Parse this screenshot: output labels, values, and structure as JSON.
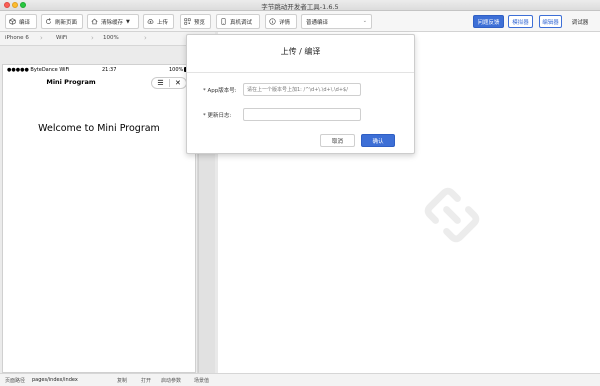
{
  "window": {
    "title": "字节跳动开发者工具-1.6.5"
  },
  "toolbar": {
    "compile": "编译",
    "refresh": "刷新页面",
    "clear_cache": "清除缓存",
    "upload": "上传",
    "preview": "预览",
    "device_debug": "真机调试",
    "details": "详情",
    "compile_mode": "普通编译",
    "feedback": "问题反馈",
    "simulator": "模拟器",
    "editor": "编辑器",
    "debugger": "调试器"
  },
  "devbar": {
    "device": "iPhone 6",
    "network": "WiFi",
    "zoom": "100%"
  },
  "phone": {
    "carrier": "●●●●● ByteDance WiFi",
    "time": "21:37",
    "battery": "100%",
    "nav_title": "Mini Program",
    "welcome": "Welcome to Mini Program"
  },
  "dialog": {
    "title": "上传 / 编译",
    "version_label": "* App版本号:",
    "version_placeholder": "请在上一个版本号上加1: /^\\d+\\.\\d+\\.\\d+$/",
    "log_label": "* 更新日志:",
    "log_value": "",
    "cancel": "取消",
    "confirm": "确认"
  },
  "bottombar": {
    "path_label": "页面路径",
    "path_value": "pages/index/index",
    "copy": "复制",
    "open": "打开",
    "start_params": "启动参数",
    "scene_value": "场景值"
  },
  "colors": {
    "accent": "#3d6fd6",
    "bg": "#d6d6d6"
  }
}
